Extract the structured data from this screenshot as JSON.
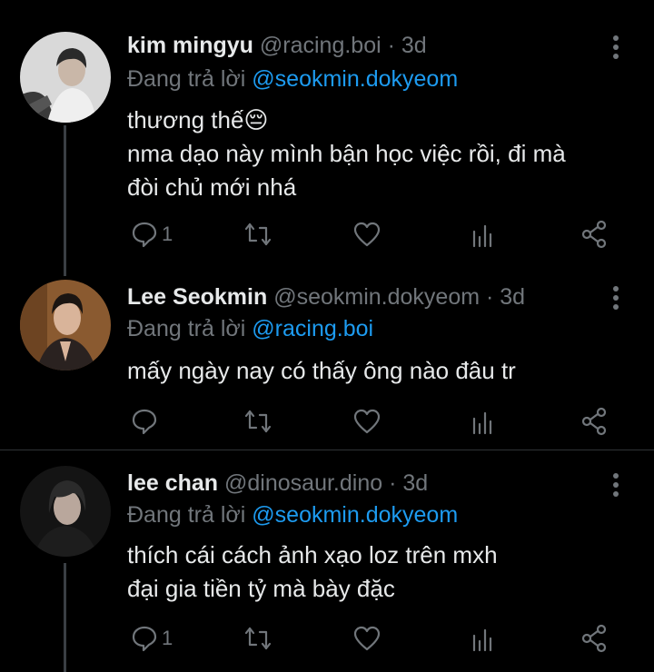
{
  "tweets": [
    {
      "name": "kim mingyu",
      "handle": "@racing.boi",
      "sep": "·",
      "time": "3d",
      "reply_prefix": "Đang trả lời",
      "reply_to": "@seokmin.dokyeom",
      "lines": [
        "thương thế😔",
        "nma dạo này mình bận học việc rồi, đi mà",
        "đòi chủ mới nhá"
      ],
      "reply_count": "1",
      "avatar_colors": {
        "bg": "#d9d9d9",
        "hair": "#2a2a2a",
        "skin": "#c9b7a8",
        "cloth": "#efefef"
      }
    },
    {
      "name": "Lee Seokmin",
      "handle": "@seokmin.dokyeom",
      "sep": "·",
      "time": "3d",
      "reply_prefix": "Đang trả lời",
      "reply_to": "@racing.boi",
      "lines": [
        "mấy ngày nay có thấy ông nào đâu tr"
      ],
      "reply_count": "",
      "avatar_colors": {
        "bg": "#8a5a30",
        "hair": "#1b1512",
        "skin": "#d9b49a",
        "cloth": "#2a2220"
      }
    },
    {
      "name": "lee chan",
      "handle": "@dinosaur.dino",
      "sep": "·",
      "time": "3d",
      "reply_prefix": "Đang trả lời",
      "reply_to": "@seokmin.dokyeom",
      "lines": [
        "thích cái cách ảnh xạo loz trên mxh",
        "đại gia tiền tỷ mà bày đặc"
      ],
      "reply_count": "1",
      "avatar_colors": {
        "bg": "#141414",
        "hair": "#2b2b2b",
        "skin": "#b9a79c",
        "cloth": "#1d1d1d"
      }
    }
  ],
  "icons": {
    "reply": "speech-bubble-icon",
    "retweet": "retweet-icon",
    "like": "heart-icon",
    "views": "bar-chart-icon",
    "share": "share-icon",
    "more": "vertical-dots-icon"
  },
  "colors": {
    "background": "#000000",
    "muted": "#71767b",
    "link": "#1d9bf0",
    "text": "#e7e9ea"
  }
}
